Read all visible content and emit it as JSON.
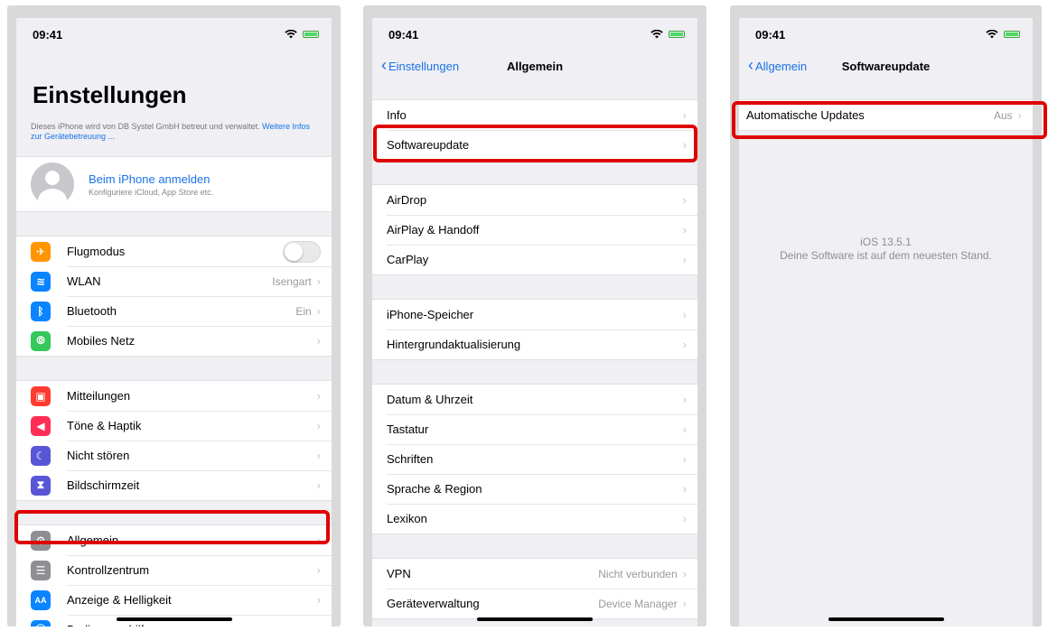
{
  "status": {
    "time": "09:41"
  },
  "screen1": {
    "title": "Einstellungen",
    "mgmt_text": "Dieses iPhone wird von DB Systel GmbH betreut und verwaltet.",
    "mgmt_link": "Weitere Infos zur Gerätebetreuung ...",
    "profile_name": "Beim iPhone anmelden",
    "profile_sub": "Konfiguriere iCloud, App Store etc.",
    "items": [
      {
        "label": "Flugmodus",
        "value": "",
        "icon": "airplane-icon",
        "color": "#ff9500",
        "glyph": "✈"
      },
      {
        "label": "WLAN",
        "value": "Isengart",
        "icon": "wifi-icon",
        "color": "#0a84ff",
        "glyph": "≋"
      },
      {
        "label": "Bluetooth",
        "value": "Ein",
        "icon": "bluetooth-icon",
        "color": "#0a84ff",
        "glyph": "ᛒ"
      },
      {
        "label": "Mobiles Netz",
        "value": "",
        "icon": "cellular-icon",
        "color": "#34c759",
        "glyph": "⦾"
      },
      {
        "label": "Mitteilungen",
        "value": "",
        "icon": "notifications-icon",
        "color": "#ff3b30",
        "glyph": "▣"
      },
      {
        "label": "Töne & Haptik",
        "value": "",
        "icon": "sounds-icon",
        "color": "#ff2d55",
        "glyph": "◀"
      },
      {
        "label": "Nicht stören",
        "value": "",
        "icon": "moon-icon",
        "color": "#5856d6",
        "glyph": "☾"
      },
      {
        "label": "Bildschirmzeit",
        "value": "",
        "icon": "hourglass-icon",
        "color": "#5856d6",
        "glyph": "⧗"
      },
      {
        "label": "Allgemein",
        "value": "",
        "icon": "gear-icon",
        "color": "#8e8e93",
        "glyph": "⚙"
      },
      {
        "label": "Kontrollzentrum",
        "value": "",
        "icon": "control-center-icon",
        "color": "#8e8e93",
        "glyph": "☰"
      },
      {
        "label": "Anzeige & Helligkeit",
        "value": "",
        "icon": "display-icon",
        "color": "#0a84ff",
        "glyph": "AA"
      },
      {
        "label": "Bedienungshilfen",
        "value": "",
        "icon": "accessibility-icon",
        "color": "#0a84ff",
        "glyph": "⓪"
      }
    ]
  },
  "screen2": {
    "back_label": "Einstellungen",
    "title": "Allgemein",
    "items": [
      {
        "label": "Info",
        "value": ""
      },
      {
        "label": "Softwareupdate",
        "value": ""
      },
      {
        "label": "AirDrop",
        "value": ""
      },
      {
        "label": "AirPlay & Handoff",
        "value": ""
      },
      {
        "label": "CarPlay",
        "value": ""
      },
      {
        "label": "iPhone-Speicher",
        "value": ""
      },
      {
        "label": "Hintergrundaktualisierung",
        "value": ""
      },
      {
        "label": "Datum & Uhrzeit",
        "value": ""
      },
      {
        "label": "Tastatur",
        "value": ""
      },
      {
        "label": "Schriften",
        "value": ""
      },
      {
        "label": "Sprache & Region",
        "value": ""
      },
      {
        "label": "Lexikon",
        "value": ""
      },
      {
        "label": "VPN",
        "value": "Nicht verbunden"
      },
      {
        "label": "Geräteverwaltung",
        "value": "Device Manager"
      }
    ]
  },
  "screen3": {
    "back_label": "Allgemein",
    "title": "Softwareupdate",
    "auto_updates_label": "Automatische Updates",
    "auto_updates_value": "Aus",
    "ios_version": "iOS 13.5.1",
    "status_message": "Deine Software ist auf dem neuesten Stand."
  },
  "colors": {
    "highlight": "#e00000",
    "link": "#1a73e8",
    "background": "#efeff4"
  }
}
